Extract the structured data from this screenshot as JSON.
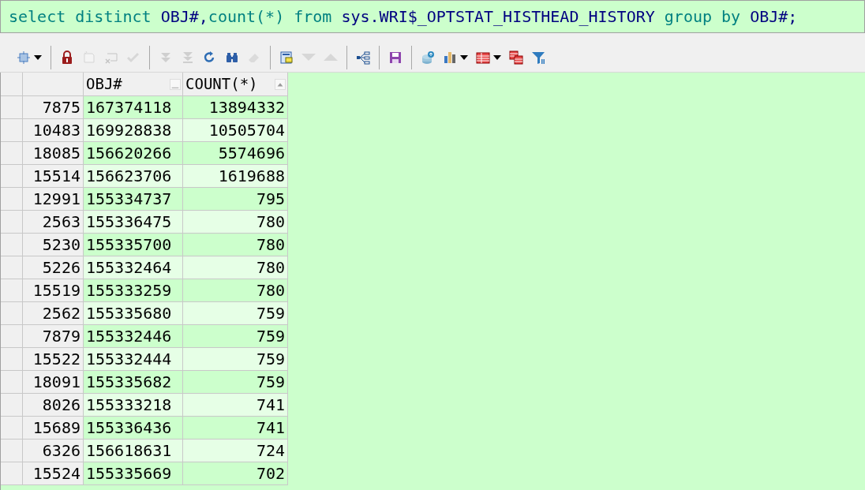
{
  "editor": {
    "tokens": [
      {
        "text": "select",
        "kind": "keyword",
        "space_before": false
      },
      {
        "text": "distinct",
        "kind": "keyword",
        "space_before": true
      },
      {
        "text": "OBJ#,",
        "kind": "ident",
        "space_before": true
      },
      {
        "text": "count(*)",
        "kind": "keyword",
        "space_before": false
      },
      {
        "text": "from",
        "kind": "keyword",
        "space_before": true
      },
      {
        "text": "sys.WRI$_OPTSTAT_HISTHEAD_HISTORY",
        "kind": "ident",
        "space_before": true
      },
      {
        "text": "group",
        "kind": "keyword",
        "space_before": true
      },
      {
        "text": "by",
        "kind": "keyword",
        "space_before": true
      },
      {
        "text": "OBJ#;",
        "kind": "ident",
        "space_before": true
      }
    ]
  },
  "toolbar": [
    [
      {
        "disabled": false,
        "dropdown": true
      }
    ],
    [
      {
        "disabled": false,
        "dropdown": false
      },
      {
        "disabled": true,
        "dropdown": false
      },
      {
        "disabled": true,
        "dropdown": false
      },
      {
        "disabled": true,
        "dropdown": false
      }
    ],
    [
      {
        "disabled": true,
        "dropdown": false
      },
      {
        "disabled": true,
        "dropdown": false
      },
      {
        "disabled": false,
        "dropdown": false
      },
      {
        "disabled": false,
        "dropdown": false
      },
      {
        "disabled": true,
        "dropdown": false
      }
    ],
    [
      {
        "disabled": false,
        "dropdown": false
      },
      {
        "disabled": true,
        "dropdown": false
      },
      {
        "disabled": true,
        "dropdown": false
      }
    ],
    [
      {
        "disabled": false,
        "dropdown": false
      }
    ],
    [
      {
        "disabled": false,
        "dropdown": false
      }
    ],
    [
      {
        "disabled": false,
        "dropdown": false
      },
      {
        "disabled": false,
        "dropdown": true
      },
      {
        "disabled": false,
        "dropdown": true
      },
      {
        "disabled": false,
        "dropdown": false
      },
      {
        "disabled": false,
        "dropdown": false
      }
    ]
  ],
  "grid": {
    "columns": [
      {
        "label": "OBJ#",
        "sorted_ascending": false
      },
      {
        "label": "COUNT(*)",
        "sorted_ascending": true
      }
    ],
    "rows": [
      {
        "row": "7875",
        "obj": "167374118",
        "count": "13894332"
      },
      {
        "row": "10483",
        "obj": "169928838",
        "count": "10505704"
      },
      {
        "row": "18085",
        "obj": "156620266",
        "count": "5574696"
      },
      {
        "row": "15514",
        "obj": "156623706",
        "count": "1619688"
      },
      {
        "row": "12991",
        "obj": "155334737",
        "count": "795"
      },
      {
        "row": "2563",
        "obj": "155336475",
        "count": "780"
      },
      {
        "row": "5230",
        "obj": "155335700",
        "count": "780"
      },
      {
        "row": "5226",
        "obj": "155332464",
        "count": "780"
      },
      {
        "row": "15519",
        "obj": "155333259",
        "count": "780"
      },
      {
        "row": "2562",
        "obj": "155335680",
        "count": "759"
      },
      {
        "row": "7879",
        "obj": "155332446",
        "count": "759"
      },
      {
        "row": "15522",
        "obj": "155332444",
        "count": "759"
      },
      {
        "row": "18091",
        "obj": "155335682",
        "count": "759"
      },
      {
        "row": "8026",
        "obj": "155333218",
        "count": "741"
      },
      {
        "row": "15689",
        "obj": "155336436",
        "count": "741"
      },
      {
        "row": "6326",
        "obj": "156618631",
        "count": "724"
      },
      {
        "row": "15524",
        "obj": "155335669",
        "count": "702"
      }
    ]
  }
}
